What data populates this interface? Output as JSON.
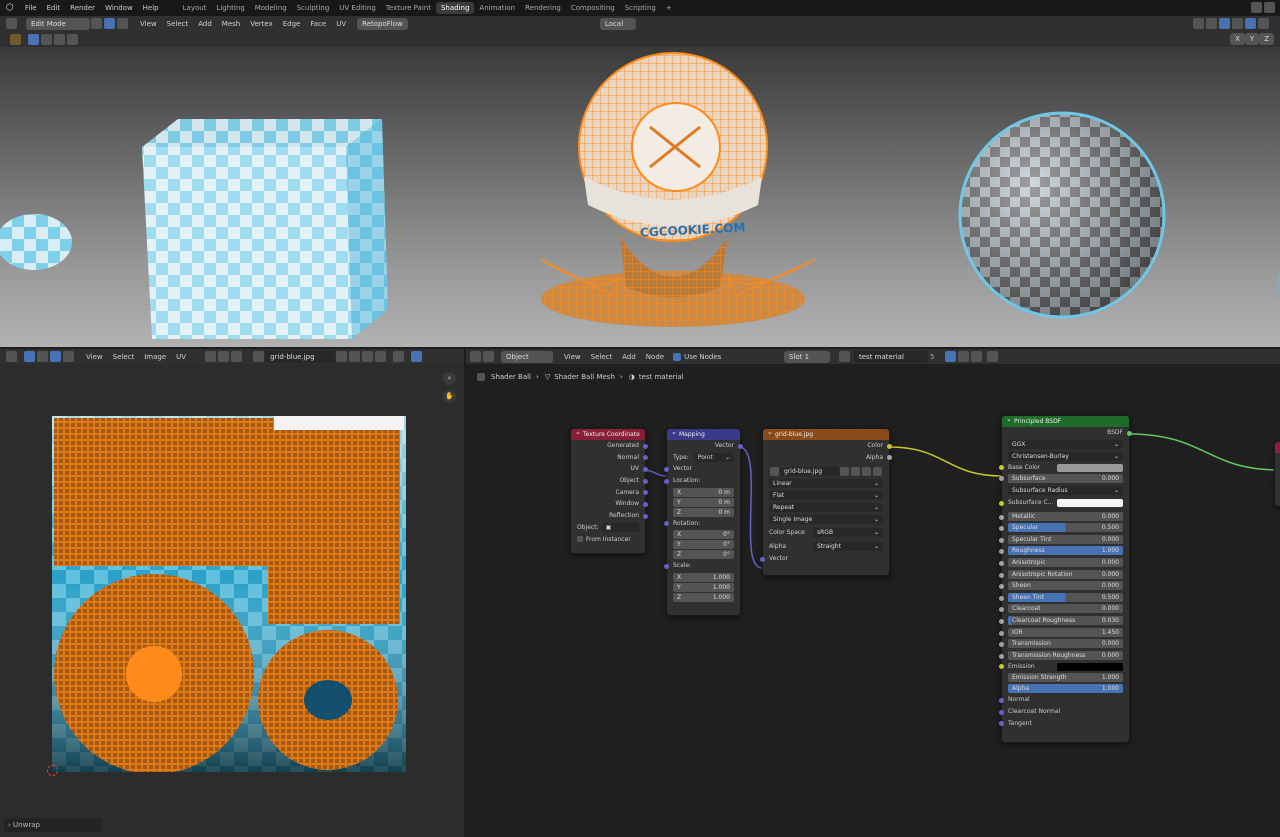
{
  "top_menu": [
    "File",
    "Edit",
    "Render",
    "Window",
    "Help"
  ],
  "workspaces": [
    "Layout",
    "Lighting",
    "Modeling",
    "Sculpting",
    "UV Editing",
    "Texture Paint",
    "Shading",
    "Animation",
    "Rendering",
    "Compositing",
    "Scripting"
  ],
  "active_workspace": "Shading",
  "viewport": {
    "mode": "Edit Mode",
    "menus": [
      "View",
      "Select",
      "Add",
      "Mesh",
      "Vertex",
      "Edge",
      "Face",
      "UV"
    ],
    "addon": "RetopoFlow",
    "transform_orientation": "Local",
    "axes": [
      "X",
      "Y",
      "Z"
    ],
    "ball_label": "CGCOOKIE.COM"
  },
  "uv_editor": {
    "menus": [
      "View",
      "Select",
      "Image",
      "UV"
    ],
    "image_name": "grid-blue.jpg",
    "operator_panel": "Unwrap"
  },
  "node_editor": {
    "object_mode": "Object",
    "menus": [
      "View",
      "Select",
      "Add",
      "Node"
    ],
    "use_nodes_label": "Use Nodes",
    "slot": "Slot 1",
    "material": "test material",
    "user_count": "5",
    "breadcrumb": [
      "Shader Ball",
      "Shader Ball Mesh",
      "test material"
    ]
  },
  "nodes": {
    "texcoord": {
      "title": "Texture Coordinate",
      "outputs": [
        "Generated",
        "Normal",
        "UV",
        "Object",
        "Camera",
        "Window",
        "Reflection"
      ],
      "object_label": "Object:",
      "from_instancer": "From Instancer"
    },
    "mapping": {
      "title": "Mapping",
      "output": "Vector",
      "type_label": "Type:",
      "type_value": "Point",
      "input_vector": "Vector",
      "location_label": "Location:",
      "location": [
        [
          "X",
          "0 m"
        ],
        [
          "Y",
          "0 m"
        ],
        [
          "Z",
          "0 m"
        ]
      ],
      "rotation_label": "Rotation:",
      "rotation": [
        [
          "X",
          "0°"
        ],
        [
          "Y",
          "0°"
        ],
        [
          "Z",
          "0°"
        ]
      ],
      "scale_label": "Scale:",
      "scale": [
        [
          "X",
          "1.000"
        ],
        [
          "Y",
          "1.000"
        ],
        [
          "Z",
          "1.000"
        ]
      ]
    },
    "image": {
      "title": "grid-blue.jpg",
      "outputs": [
        "Color",
        "Alpha"
      ],
      "image_name": "grid-blue.jpg",
      "interpolation": "Linear",
      "projection": "Flat",
      "extension": "Repeat",
      "source": "Single Image",
      "color_space_label": "Color Space",
      "color_space": "sRGB",
      "alpha_label": "Alpha",
      "alpha_mode": "Straight",
      "input_vector": "Vector"
    },
    "bsdf": {
      "title": "Principled BSDF",
      "output": "BSDF",
      "distribution": "GGX",
      "subsurface_method": "Christensen-Burley",
      "base_color_label": "Base Color",
      "subsurface_radius": "Subsurface Radius",
      "subsurface_color_label": "Subsurface C...",
      "params": [
        {
          "label": "Subsurface",
          "value": "0.000",
          "fill": 0
        },
        {
          "label": "Metallic",
          "value": "0.000",
          "fill": 0
        },
        {
          "label": "Specular",
          "value": "0.500",
          "fill": 0.5
        },
        {
          "label": "Specular Tint",
          "value": "0.000",
          "fill": 0
        },
        {
          "label": "Roughness",
          "value": "1.000",
          "fill": 1
        },
        {
          "label": "Anisotropic",
          "value": "0.000",
          "fill": 0
        },
        {
          "label": "Anisotropic Rotation",
          "value": "0.000",
          "fill": 0
        },
        {
          "label": "Sheen",
          "value": "0.000",
          "fill": 0
        },
        {
          "label": "Sheen Tint",
          "value": "0.500",
          "fill": 0.5
        },
        {
          "label": "Clearcoat",
          "value": "0.000",
          "fill": 0
        },
        {
          "label": "Clearcoat Roughness",
          "value": "0.030",
          "fill": 0.03
        },
        {
          "label": "IOR",
          "value": "1.450",
          "fill": 0
        },
        {
          "label": "Transmission",
          "value": "0.000",
          "fill": 0
        },
        {
          "label": "Transmission Roughness",
          "value": "0.000",
          "fill": 0
        }
      ],
      "emission_label": "Emission",
      "emission_strength": {
        "label": "Emission Strength",
        "value": "1.000"
      },
      "alpha": {
        "label": "Alpha",
        "value": "1.000",
        "fill": 1
      },
      "normal": "Normal",
      "clearcoat_normal": "Clearcoat Normal",
      "tangent": "Tangent"
    }
  },
  "colors": {
    "accent": "#4772b3",
    "select_orange": "#ff8c1a",
    "bsdf_header": "#1f6b2a",
    "image_header": "#8a4a1a",
    "mapping_header": "#3a3a8a",
    "texcoord_header": "#8a1f3a"
  }
}
